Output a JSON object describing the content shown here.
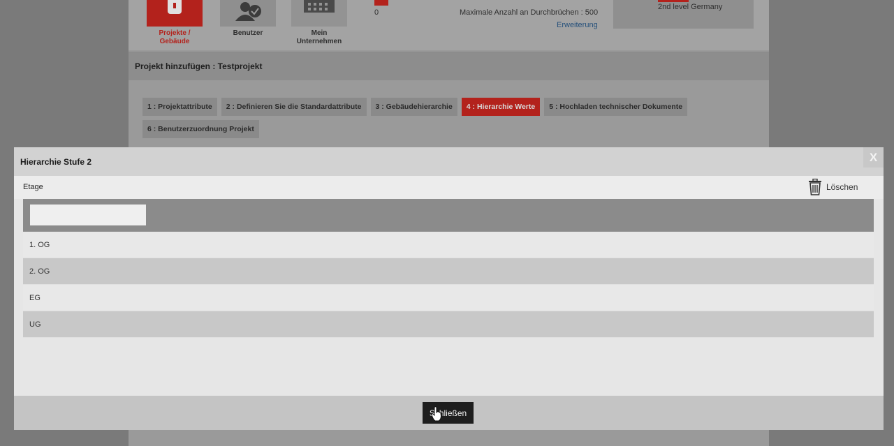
{
  "nav": {
    "tiles": [
      {
        "label_line1": "Projekte /",
        "label_line2": "Gebäude",
        "icon": "project-icon"
      },
      {
        "label_line1": "Benutzer",
        "label_line2": "",
        "icon": "user-check-icon"
      },
      {
        "label_line1": "Mein",
        "label_line2": "Unternehmen",
        "icon": "building-icon"
      }
    ]
  },
  "stats": {
    "count": "0",
    "max_openings": "Maximale Anzahl an Durchbrüchen : 500",
    "extension_link": "Erweiterung"
  },
  "account": {
    "name": "2nd level Germany"
  },
  "project": {
    "title": "Projekt hinzufügen : Testprojekt"
  },
  "steps": [
    {
      "label": "1 : Projektattribute",
      "active": false
    },
    {
      "label": "2 : Definieren Sie die Standardattribute",
      "active": false
    },
    {
      "label": "3 : Gebäudehierarchie",
      "active": false
    },
    {
      "label": "4 : Hierarchie Werte",
      "active": true
    },
    {
      "label": "5 : Hochladen technischer Dokumente",
      "active": false
    },
    {
      "label": "6 : Benutzerzuordnung Projekt",
      "active": false
    }
  ],
  "modal": {
    "title": "Hierarchie Stufe 2",
    "close_x": "X",
    "field_label": "Etage",
    "delete_label": "Löschen",
    "input_value": "",
    "input_placeholder": "",
    "rows": [
      "1. OG",
      "2. OG",
      "EG",
      "UG"
    ],
    "close_button": "Schließen"
  },
  "colors": {
    "accent": "#b3221c",
    "overlay": "#7a7a7a",
    "button_dark": "#1e1e1e"
  }
}
